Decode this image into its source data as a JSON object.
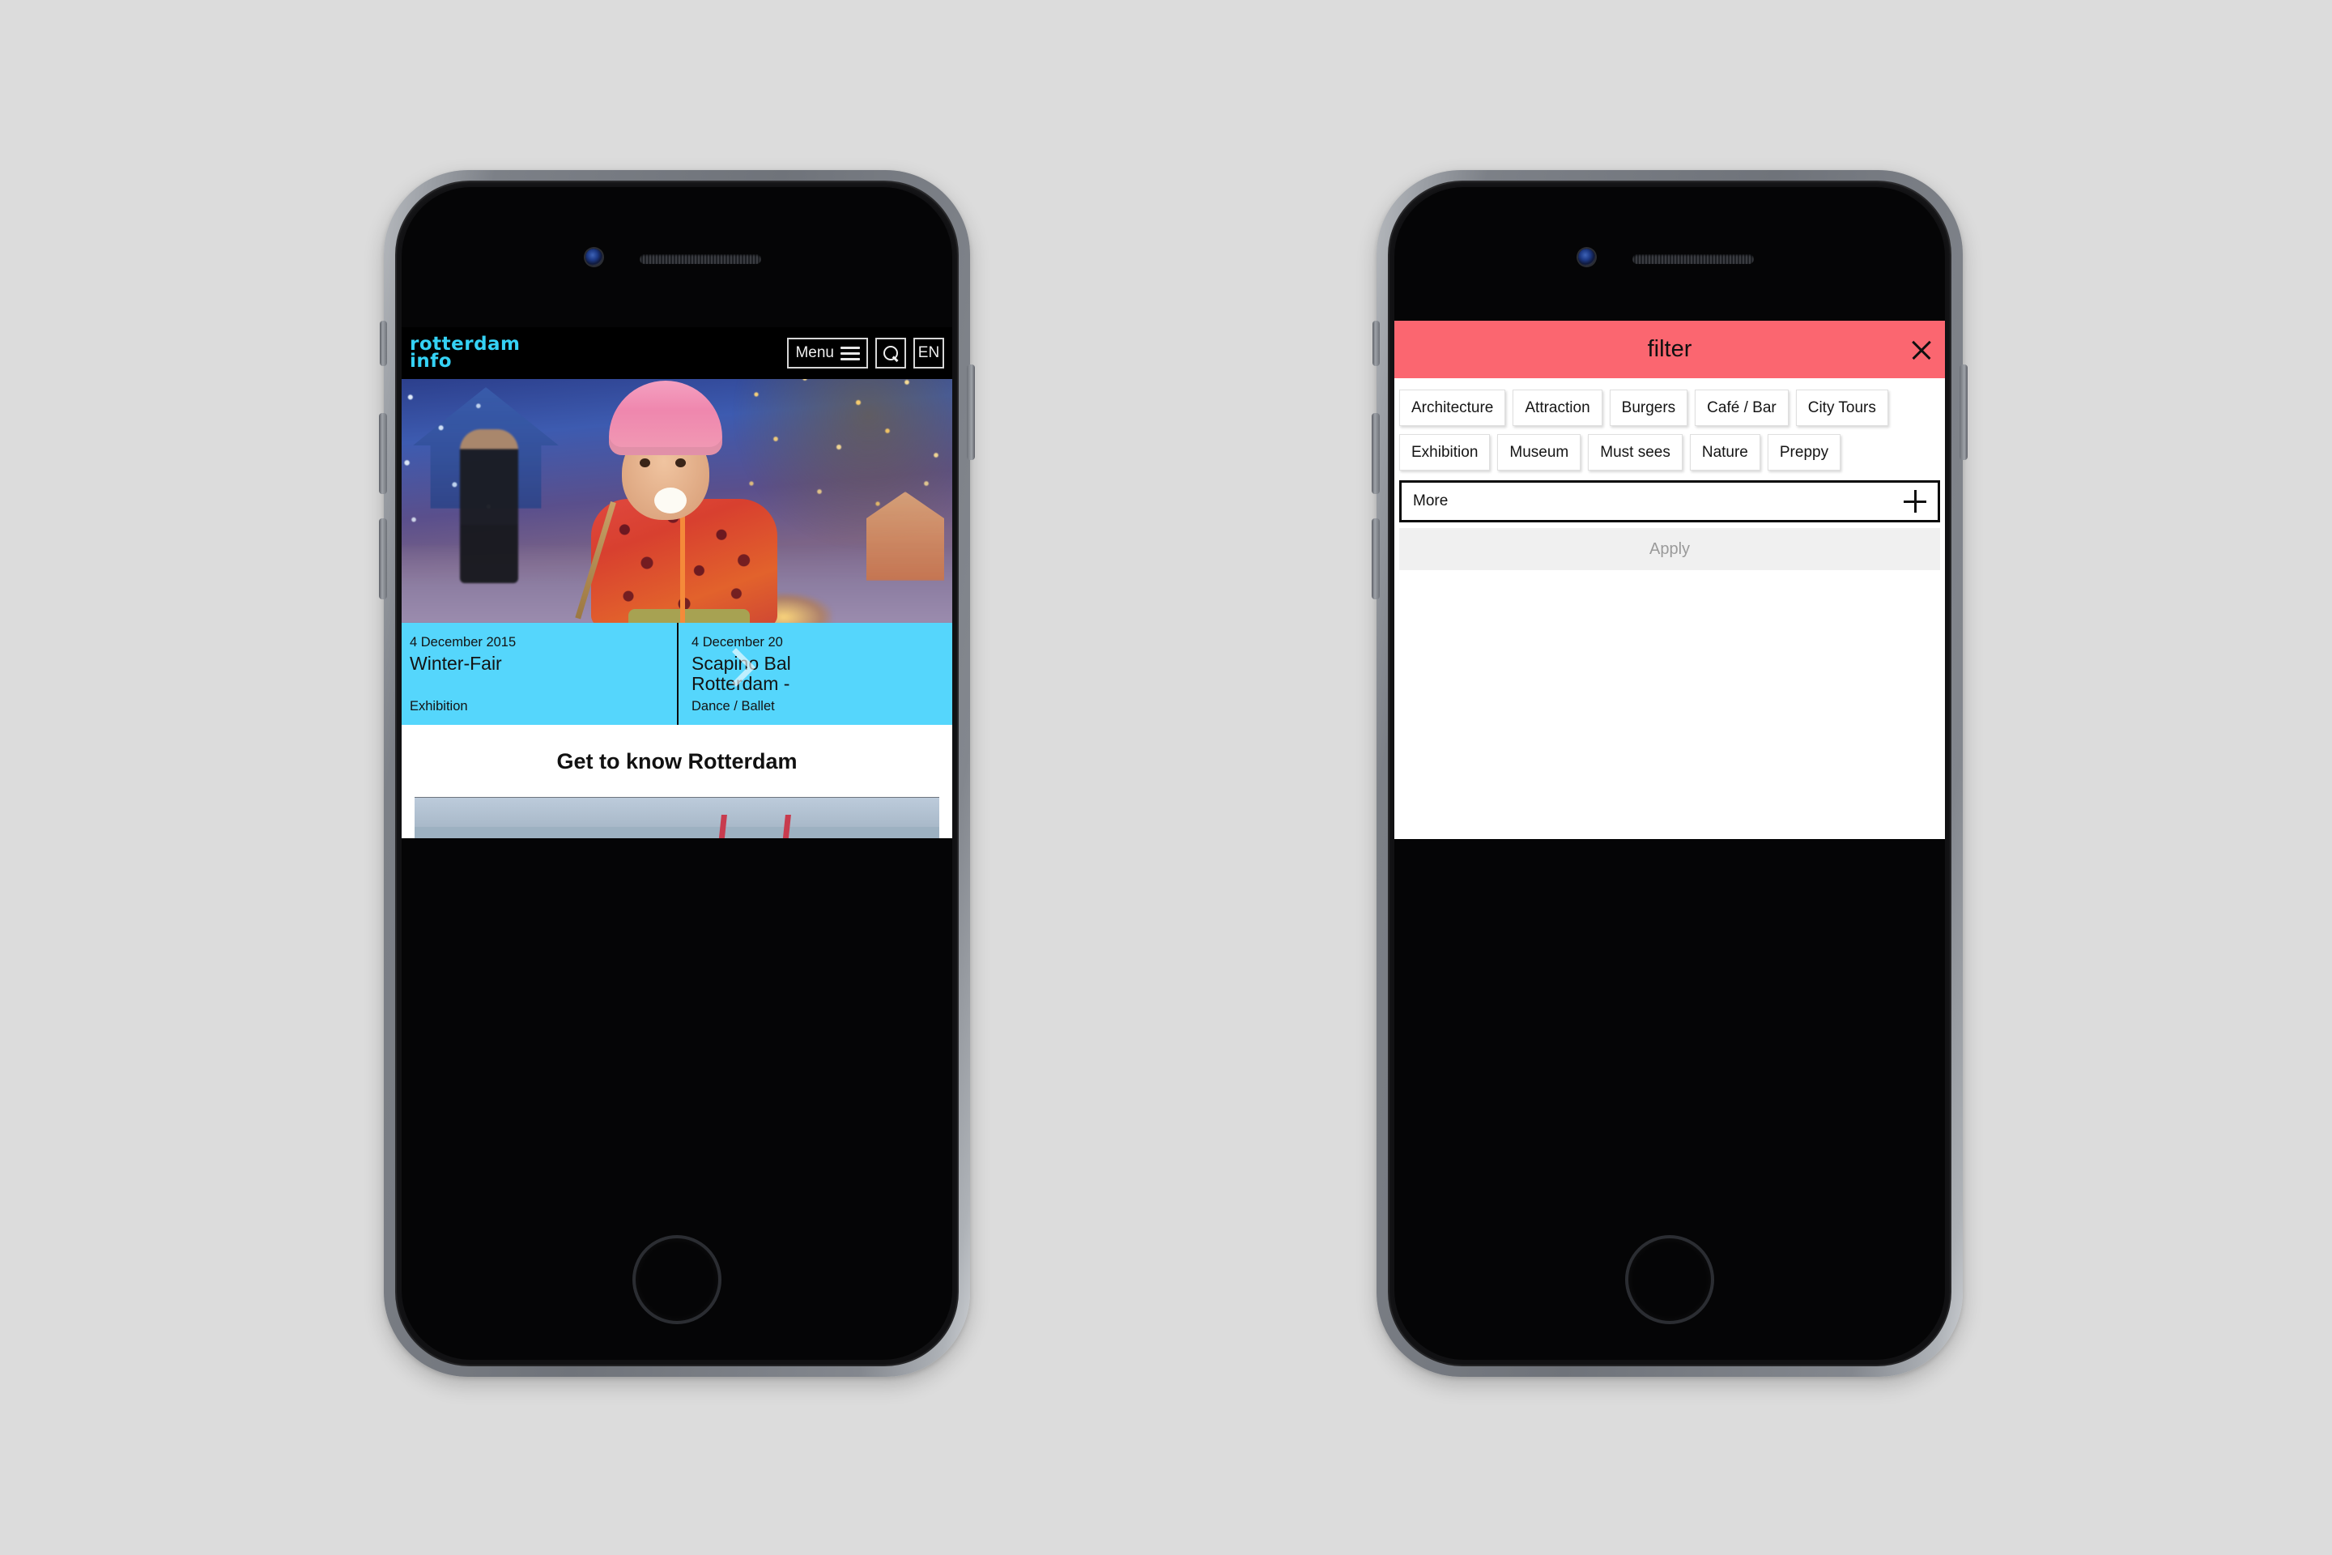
{
  "canvas": {
    "background": "#dcdcdc"
  },
  "phones": {
    "left": {
      "site": {
        "header": {
          "logo_line1": "rotterdam",
          "logo_line2": "info",
          "logo_color": "#35d2f5",
          "menu_label": "Menu",
          "search_label": "",
          "language_label": "EN"
        },
        "hero": {
          "alt": "Girl in pink hat eating marshmallow at winter fair"
        },
        "events": {
          "accent_color": "#55d6fc",
          "items": [
            {
              "date": "4 December 2015",
              "title_line1": "Winter-Fair",
              "title_line2": "",
              "category": "Exhibition"
            },
            {
              "date": "4 December 20",
              "title_line1": "Scapino Bal",
              "title_line2": "Rotterdam -",
              "category": "Dance / Ballet"
            }
          ]
        },
        "section": {
          "heading": "Get to know Rotterdam"
        }
      }
    },
    "right": {
      "filter": {
        "header_color": "#fb6670",
        "title": "filter",
        "close_label": "",
        "tags": [
          "Architecture",
          "Attraction",
          "Burgers",
          "Café / Bar",
          "City Tours",
          "Exhibition",
          "Museum",
          "Must sees",
          "Nature",
          "Preppy"
        ],
        "more_label": "More",
        "apply_label": "Apply"
      }
    }
  }
}
